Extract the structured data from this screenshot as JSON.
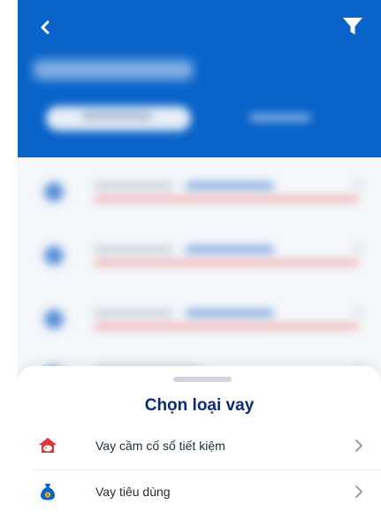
{
  "header": {
    "back_icon": "chevron-left-icon",
    "filter_icon": "filter-icon",
    "background_color": "#0a63c9"
  },
  "sheet": {
    "title": "Chọn loại vay",
    "title_color": "#0b2c74",
    "options": [
      {
        "label": "Vay cầm cố sổ tiết kiệm",
        "icon": "home-piggy-icon",
        "icon_color": "#e2343f"
      },
      {
        "label": "Vay tiêu dùng",
        "icon": "money-bag-icon",
        "icon_color": "#0a63c9"
      }
    ]
  }
}
